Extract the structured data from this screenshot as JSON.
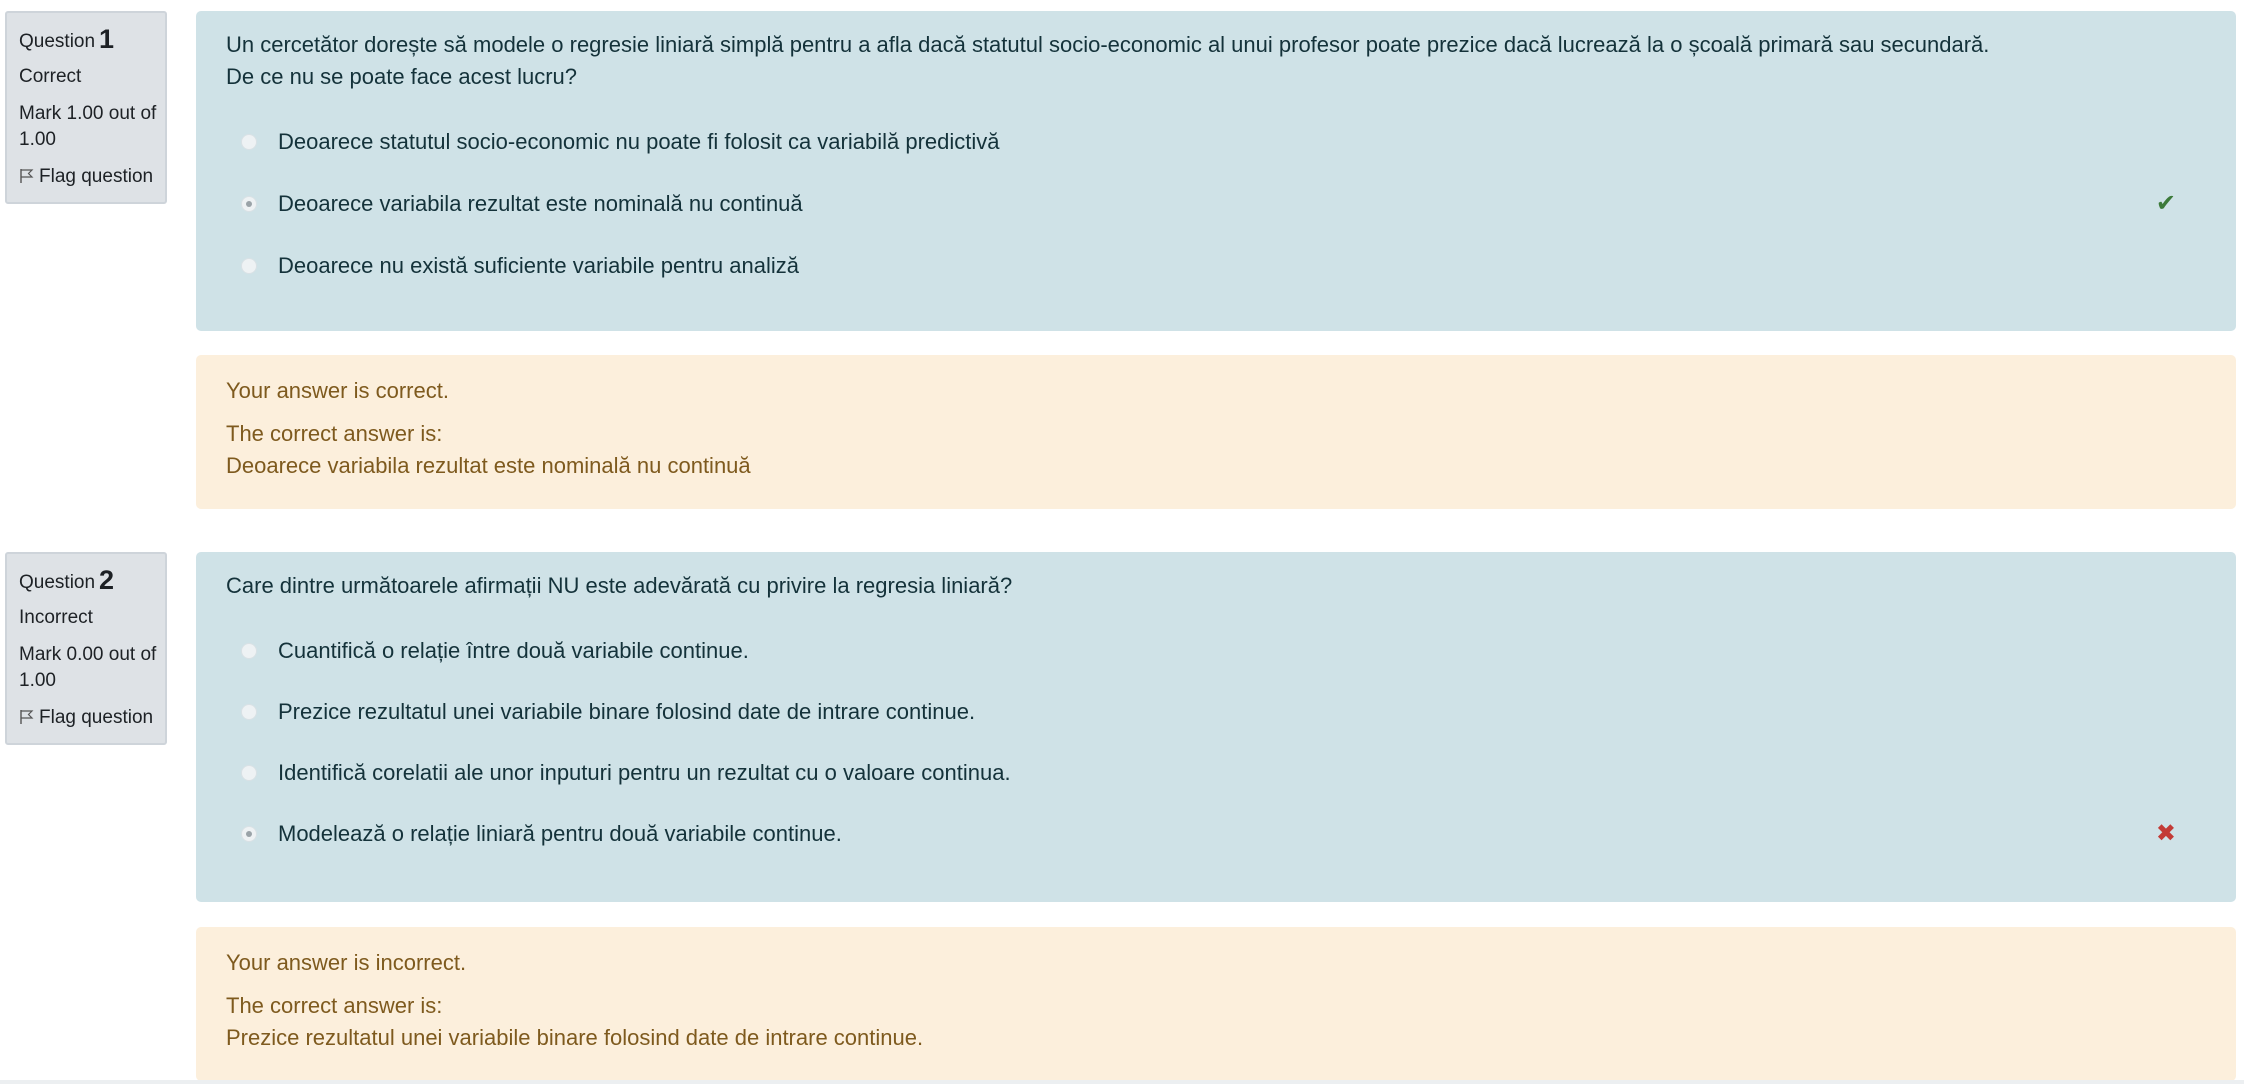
{
  "questions": [
    {
      "label": "Question",
      "number": "1",
      "state": "Correct",
      "grade": "Mark 1.00 out of 1.00",
      "flag": "Flag question",
      "text_line1": "Un cercetător dorește să modele o regresie liniară simplă pentru a afla dacă statutul socio-economic al unui profesor poate prezice dacă lucrează la o școală primară sau secundară.",
      "text_line2": "De ce nu se poate face acest lucru?",
      "answers": [
        {
          "text": "Deoarece statutul socio-economic nu poate fi folosit ca variabilă predictivă",
          "selected": false
        },
        {
          "text": "Deoarece variabila rezultat este nominală nu continuă",
          "selected": true,
          "mark": "correct"
        },
        {
          "text": "Deoarece nu există suficiente variabile pentru analiză",
          "selected": false
        }
      ],
      "feedback": {
        "result": "Your answer is correct.",
        "correct_label": "The correct answer is:",
        "correct_answer": "Deoarece variabila rezultat este nominală nu continuă"
      }
    },
    {
      "label": "Question",
      "number": "2",
      "state": "Incorrect",
      "grade": "Mark 0.00 out of 1.00",
      "flag": "Flag question",
      "text_line1": "Care dintre următoarele afirmații NU este adevărată cu privire la regresia liniară?",
      "answers": [
        {
          "text": "Cuantifică o relație între două variabile continue.",
          "selected": false
        },
        {
          "text": "Prezice rezultatul unei variabile binare folosind date de intrare continue.",
          "selected": false
        },
        {
          "text": "Identifică corelatii ale unor inputuri pentru un rezultat cu o valoare continua.",
          "selected": false
        },
        {
          "text": "Modelează o relație liniară pentru două variabile continue.",
          "selected": true,
          "mark": "incorrect"
        }
      ],
      "feedback": {
        "result": "Your answer is incorrect.",
        "correct_label": "The correct answer is:",
        "correct_answer": "Prezice rezultatul unei variabile binare folosind date de intrare continue."
      }
    }
  ],
  "icons": {
    "correct": "check-icon",
    "incorrect": "cross-icon",
    "flag": "flag-icon"
  },
  "colors": {
    "formulation_bg": "#cfe2e7",
    "feedback_bg": "#fcefdc",
    "info_bg": "#dee2e6",
    "correct": "#3c7a3a",
    "incorrect": "#c33b36"
  }
}
